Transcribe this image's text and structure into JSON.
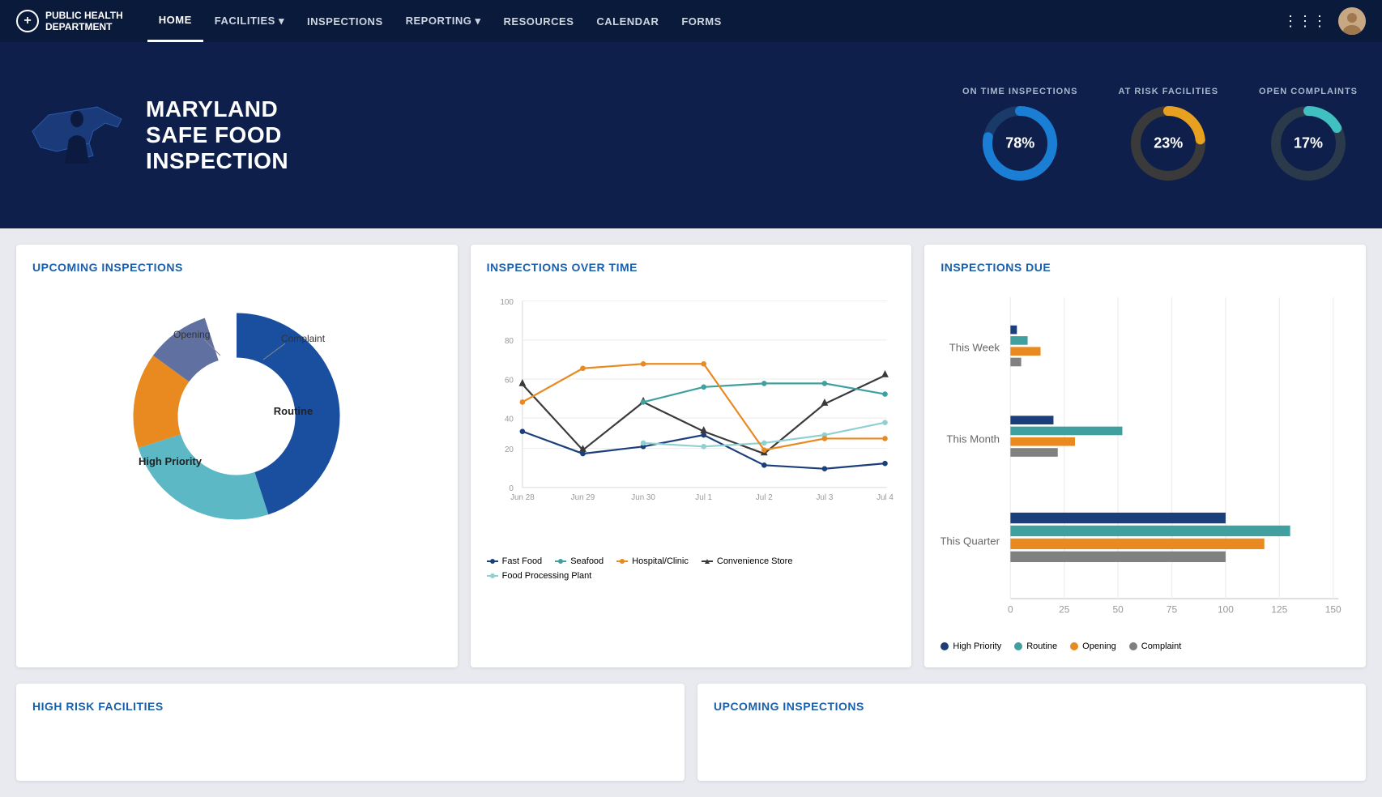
{
  "nav": {
    "logo_line1": "PUBLIC HEALTH",
    "logo_line2": "DEPARTMENT",
    "links": [
      {
        "label": "HOME",
        "active": true,
        "has_dropdown": false
      },
      {
        "label": "FACILITIES",
        "active": false,
        "has_dropdown": true
      },
      {
        "label": "INSPECTIONS",
        "active": false,
        "has_dropdown": false
      },
      {
        "label": "REPORTING",
        "active": false,
        "has_dropdown": true
      },
      {
        "label": "RESOURCES",
        "active": false,
        "has_dropdown": false
      },
      {
        "label": "CALENDAR",
        "active": false,
        "has_dropdown": false
      },
      {
        "label": "FORMS",
        "active": false,
        "has_dropdown": false
      }
    ]
  },
  "hero": {
    "title_line1": "MARYLAND",
    "title_line2": "SAFE FOOD",
    "title_line3": "INSPECTION",
    "metrics": [
      {
        "label": "ON TIME INSPECTIONS",
        "value": "78%",
        "percent": 78,
        "color": "#1a7fd4"
      },
      {
        "label": "AT RISK FACILITIES",
        "value": "23%",
        "percent": 23,
        "color": "#e8a020"
      },
      {
        "label": "OPEN COMPLAINTS",
        "value": "17%",
        "percent": 17,
        "color": "#40c0c0"
      }
    ]
  },
  "upcoming_inspections": {
    "title": "UPCOMING INSPECTIONS",
    "segments": [
      {
        "label": "Routine",
        "value": 45,
        "color": "#1a4fa0"
      },
      {
        "label": "High Priority",
        "value": 25,
        "color": "#5cb8c4"
      },
      {
        "label": "Opening",
        "value": 15,
        "color": "#e88a20"
      },
      {
        "label": "Complaint",
        "value": 10,
        "color": "#6070a0"
      }
    ]
  },
  "inspections_over_time": {
    "title": "INSPECTIONS OVER TIME",
    "x_labels": [
      "Jun 28",
      "Jun 29",
      "Jun 30",
      "Jul 1",
      "Jul 2",
      "Jul 3",
      "Jul 4"
    ],
    "y_labels": [
      "0",
      "20",
      "40",
      "60",
      "80",
      "100"
    ],
    "series": [
      {
        "label": "Fast Food",
        "color": "#1a3f7a",
        "style": "circle",
        "values": [
          30,
          18,
          22,
          28,
          12,
          10,
          13
        ]
      },
      {
        "label": "Convenience Store",
        "color": "#3a3a3a",
        "style": "triangle",
        "values": [
          55,
          20,
          46,
          30,
          18,
          45,
          60
        ]
      },
      {
        "label": "Seafood",
        "color": "#40a0a0",
        "style": "circle",
        "values": [
          null,
          null,
          46,
          54,
          56,
          56,
          50
        ]
      },
      {
        "label": "Food Processing Plant",
        "color": "#90d0d0",
        "style": "circle",
        "values": [
          null,
          null,
          24,
          22,
          24,
          28,
          35
        ]
      },
      {
        "label": "Hospital/Clinic",
        "color": "#e88a20",
        "style": "circle",
        "values": [
          46,
          64,
          66,
          66,
          20,
          26,
          26
        ]
      }
    ]
  },
  "inspections_due": {
    "title": "INSPECTIONS DUE",
    "categories": [
      "This Week",
      "This Month",
      "This Quarter"
    ],
    "bars": [
      {
        "category": "This Week",
        "high_priority": 3,
        "routine": 8,
        "opening": 14,
        "complaint": 5
      },
      {
        "category": "This Month",
        "high_priority": 20,
        "routine": 52,
        "opening": 30,
        "complaint": 22
      },
      {
        "category": "This Quarter",
        "high_priority": 100,
        "routine": 130,
        "opening": 118,
        "complaint": 100
      }
    ],
    "legend": [
      {
        "label": "High Priority",
        "color": "#1a3f7a"
      },
      {
        "label": "Routine",
        "color": "#40a0a0"
      },
      {
        "label": "Opening",
        "color": "#e88a20"
      },
      {
        "label": "Complaint",
        "color": "#808080"
      }
    ],
    "x_labels": [
      "0",
      "25",
      "50",
      "75",
      "100",
      "125",
      "150"
    ],
    "max": 150
  },
  "bottom_left": {
    "title": "HIGH RISK FACILITIES"
  },
  "bottom_right": {
    "title": "UPCOMING INSPECTIONS"
  }
}
